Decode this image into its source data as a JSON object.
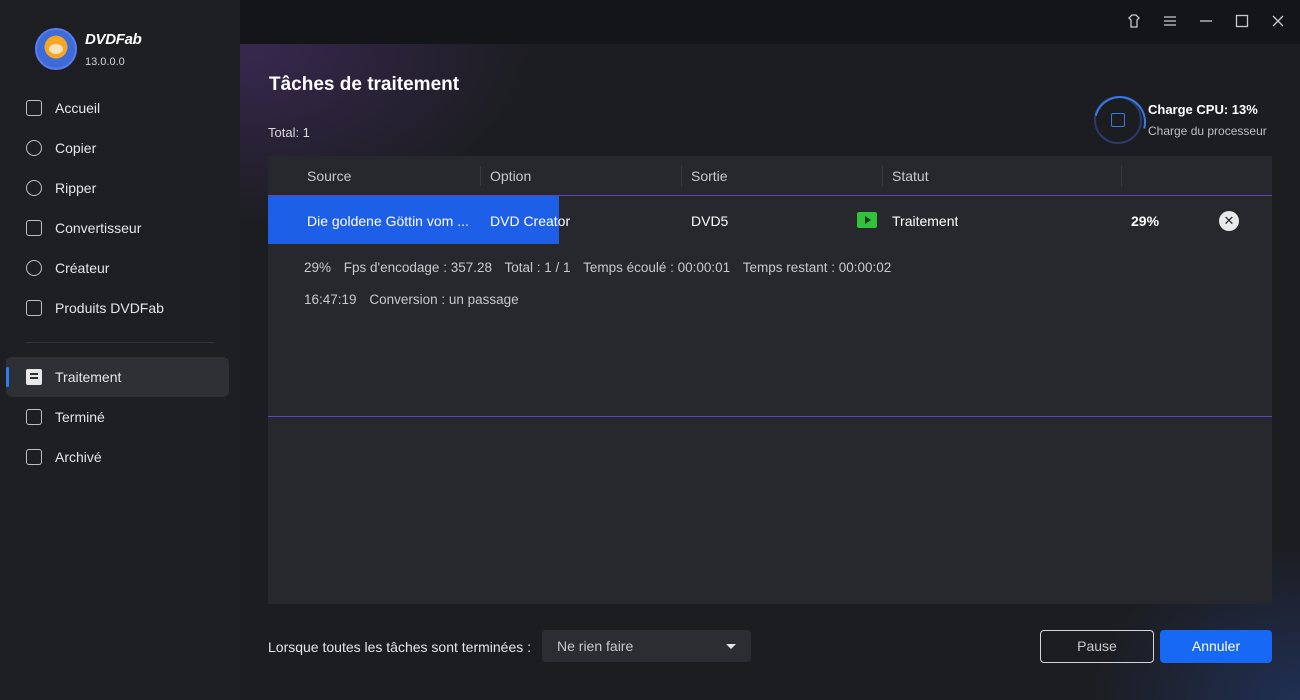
{
  "app": {
    "brand": "DVDFab",
    "version": "13.0.0.0"
  },
  "sidebar": {
    "items": [
      {
        "label": "Accueil",
        "icon": "home-icon"
      },
      {
        "label": "Copier",
        "icon": "copy-disc-icon"
      },
      {
        "label": "Ripper",
        "icon": "ripper-icon"
      },
      {
        "label": "Convertisseur",
        "icon": "film-icon"
      },
      {
        "label": "Créateur",
        "icon": "disc-icon"
      },
      {
        "label": "Produits DVDFab",
        "icon": "products-icon"
      }
    ],
    "task_items": [
      {
        "label": "Traitement",
        "icon": "processing-icon",
        "active": true
      },
      {
        "label": "Terminé",
        "icon": "completed-icon"
      },
      {
        "label": "Archivé",
        "icon": "archive-icon"
      }
    ]
  },
  "main": {
    "title": "Tâches de traitement",
    "total": "Total: 1",
    "cpu": {
      "label": "Charge CPU: 13%",
      "sub": "Charge du processeur",
      "percent": 13
    },
    "table": {
      "headers": [
        "Source",
        "Option",
        "Sortie",
        "Statut"
      ],
      "row": {
        "source": "Die goldene Göttin vom ...",
        "option": "DVD Creator",
        "output": "DVD5",
        "status": "Traitement",
        "progress_label": "29%",
        "progress": 0.29
      }
    },
    "details": {
      "line1": {
        "percent": "29%",
        "fps": "Fps d'encodage : 357.28",
        "total": "Total : 1 / 1",
        "elapsed": "Temps écoulé : 00:00:01",
        "remaining": "Temps restant : 00:00:02"
      },
      "line2": {
        "time": "16:47:19",
        "text": "Conversion : un passage"
      }
    }
  },
  "footer": {
    "label": "Lorsque toutes les tâches sont terminées :",
    "select_value": "Ne rien faire",
    "pause_label": "Pause",
    "cancel_label": "Annuler"
  },
  "colors": {
    "accent": "#1769f5",
    "progress": "#1e5fe8",
    "status_play": "#32c23a"
  }
}
